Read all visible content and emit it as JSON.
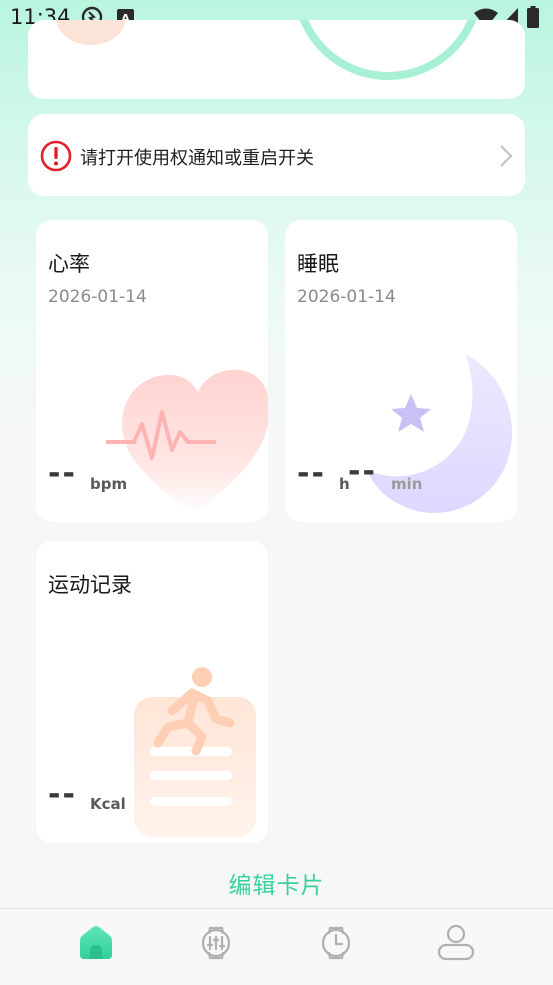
{
  "status_bar": {
    "time": "11:34",
    "icons": [
      "app-notification-icon",
      "keyboard-a-icon",
      "wifi-icon",
      "cell-signal-icon",
      "battery-icon"
    ]
  },
  "notice": {
    "text": "请打开使用权通知或重启开关",
    "icon": "exclamation-circle-icon"
  },
  "cards": {
    "heart_rate": {
      "title": "心率",
      "date": "2026-01-14",
      "value": "--",
      "unit": "bpm"
    },
    "sleep": {
      "title": "睡眠",
      "date": "2026-01-14",
      "hours": "--",
      "hours_unit": "h",
      "minutes": "--",
      "minutes_unit": "min"
    },
    "sport": {
      "title": "运动记录",
      "value": "--",
      "unit": "Kcal"
    }
  },
  "edit_cards_label": "编辑卡片",
  "tabbar": {
    "items": [
      {
        "name": "home",
        "icon": "home-icon",
        "active": true
      },
      {
        "name": "device",
        "icon": "watch-settings-icon",
        "active": false
      },
      {
        "name": "watch",
        "icon": "watch-clock-icon",
        "active": false
      },
      {
        "name": "profile",
        "icon": "user-icon",
        "active": false
      }
    ]
  },
  "colors": {
    "accent": "#3bd19a",
    "warning": "#e0202a",
    "heart": "#ffb3b3",
    "moon": "#e0dcff"
  }
}
